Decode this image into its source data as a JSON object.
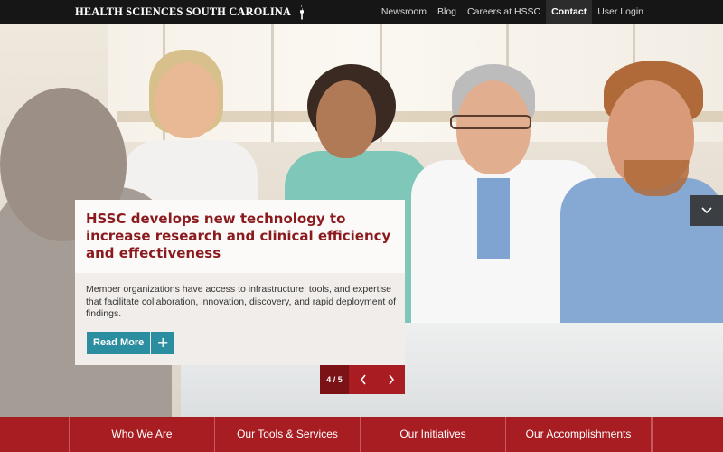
{
  "brand": {
    "name": "HEALTH SCIENCES SOUTH CAROLINA",
    "logo_icon": "torch-icon"
  },
  "top_nav": {
    "items": [
      {
        "label": "Newsroom",
        "active": false
      },
      {
        "label": "Blog",
        "active": false
      },
      {
        "label": "Careers at HSSC",
        "active": false
      },
      {
        "label": "Contact",
        "active": true
      },
      {
        "label": "User Login",
        "active": false
      }
    ]
  },
  "slide": {
    "title": "HSSC develops new technology to increase research and clinical efficiency and effectiveness",
    "summary": "Member organizations have access to infrastructure, tools, and expertise that facilitate collaboration, innovation, discovery, and rapid deployment of findings.",
    "read_more_label": "Read More",
    "read_more_plus": "+",
    "counter": "4 / 5",
    "prev_icon": "chevron-left-icon",
    "next_icon": "chevron-right-icon"
  },
  "side_toggle_icon": "chevron-down-icon",
  "bottom_nav": {
    "items": [
      {
        "label": "Who We Are"
      },
      {
        "label": "Our Tools & Services"
      },
      {
        "label": "Our Initiatives"
      },
      {
        "label": "Our Accomplishments"
      }
    ]
  },
  "colors": {
    "brand_red": "#a71d21",
    "dark_red": "#7b1216",
    "title_red": "#8b1a1e",
    "teal": "#2b8ea0",
    "topbar": "#161616"
  }
}
